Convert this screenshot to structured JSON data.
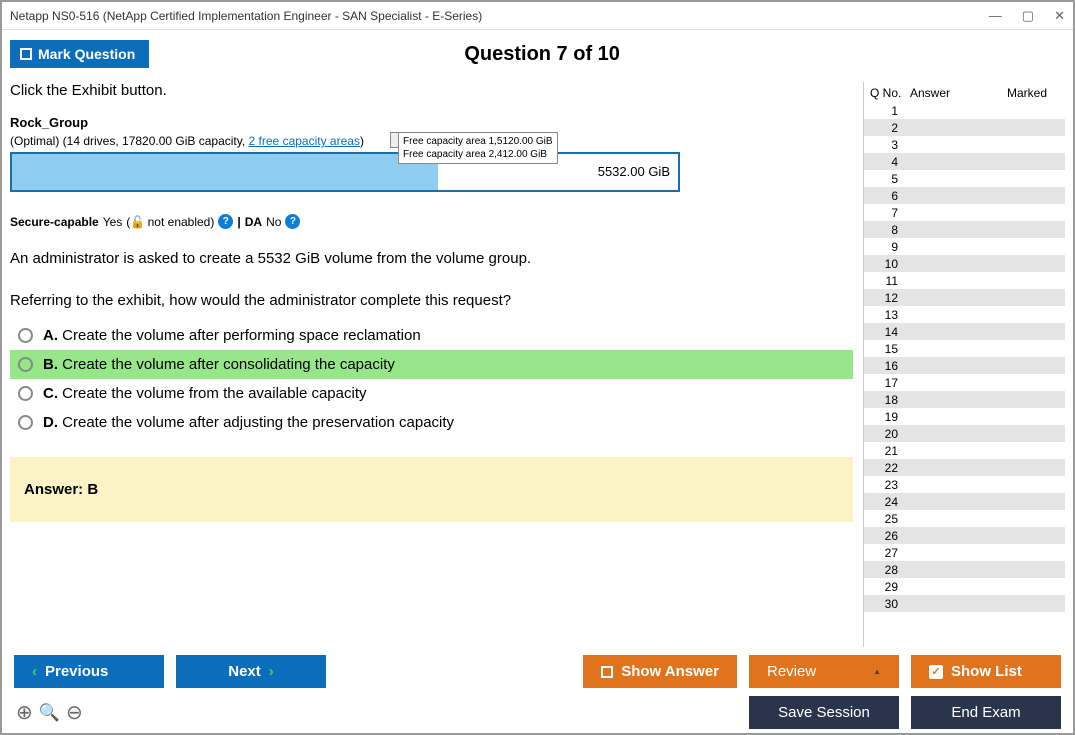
{
  "window": {
    "title": "Netapp NS0-516 (NetApp Certified Implementation Engineer - SAN Specialist - E-Series)"
  },
  "header": {
    "mark_label": "Mark Question",
    "question_title": "Question 7 of 10"
  },
  "question": {
    "instruction": "Click the Exhibit button.",
    "exhibit": {
      "group_name": "Rock_Group",
      "summary_prefix": "(Optimal) (14 drives, 17820.00 GiB capacity, ",
      "summary_link": "2 free capacity areas",
      "summary_suffix": ")",
      "tooltip_line1": "Free capacity area 1,5120.00 GiB",
      "tooltip_line2": "Free capacity area 2,412.00 GiB",
      "free_label": "5532.00 GiB",
      "secure_prefix": "Secure-capable",
      "secure_yes": "Yes",
      "secure_note": "( not enabled)",
      "da_label": "DA",
      "da_value": "No"
    },
    "body_line1": "An administrator is asked to create a 5532 GiB volume from the volume group.",
    "body_line2": "Referring to the exhibit, how would the administrator complete this request?",
    "options": [
      {
        "letter": "A.",
        "text": "Create the volume after performing space reclamation",
        "correct": false
      },
      {
        "letter": "B.",
        "text": "Create the volume after consolidating the capacity",
        "correct": true
      },
      {
        "letter": "C.",
        "text": "Create the volume from the available capacity",
        "correct": false
      },
      {
        "letter": "D.",
        "text": "Create the volume after adjusting the preservation capacity",
        "correct": false
      }
    ],
    "answer_label": "Answer: B"
  },
  "sidebar": {
    "col_qno": "Q No.",
    "col_answer": "Answer",
    "col_marked": "Marked",
    "rows": [
      1,
      2,
      3,
      4,
      5,
      6,
      7,
      8,
      9,
      10,
      11,
      12,
      13,
      14,
      15,
      16,
      17,
      18,
      19,
      20,
      21,
      22,
      23,
      24,
      25,
      26,
      27,
      28,
      29,
      30
    ]
  },
  "buttons": {
    "previous": "Previous",
    "next": "Next",
    "show_answer": "Show Answer",
    "review": "Review",
    "show_list": "Show List",
    "save_session": "Save Session",
    "end_exam": "End Exam"
  }
}
